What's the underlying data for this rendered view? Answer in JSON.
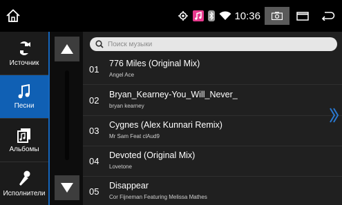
{
  "status_bar": {
    "time": "10:36",
    "icons": [
      "home-icon",
      "location-icon",
      "music-app-icon",
      "bluetooth-icon",
      "wifi-icon",
      "camera-icon",
      "window-icon",
      "back-icon"
    ],
    "accent_music": "#e83a8e"
  },
  "sidebar": {
    "items": [
      {
        "label": "Источник",
        "icon": "source-icon"
      },
      {
        "label": "Песни",
        "icon": "music-note-icon",
        "active": true
      },
      {
        "label": "Альбомы",
        "icon": "albums-icon"
      },
      {
        "label": "Исполнители",
        "icon": "microphone-icon"
      }
    ],
    "active_color": "#1060b4"
  },
  "search": {
    "placeholder": "Поиск музыки"
  },
  "songs": [
    {
      "num": "01",
      "title": "776 Miles (Original Mix)",
      "artist": "Angel Ace"
    },
    {
      "num": "02",
      "title": "Bryan_Kearney-You_Will_Never_",
      "artist": "bryan kearney"
    },
    {
      "num": "03",
      "title": "Cygnes  (Alex Kunnari Remix)",
      "artist": "Mr Sam Feat clAud9"
    },
    {
      "num": "04",
      "title": "Devoted (Original Mix)",
      "artist": "Lovetone"
    },
    {
      "num": "05",
      "title": "Disappear",
      "artist": "Cor Fijneman Featuring Melissa Mathes"
    }
  ],
  "colors": {
    "accent": "#1466bd",
    "next_arrow": "#2a78d0"
  }
}
